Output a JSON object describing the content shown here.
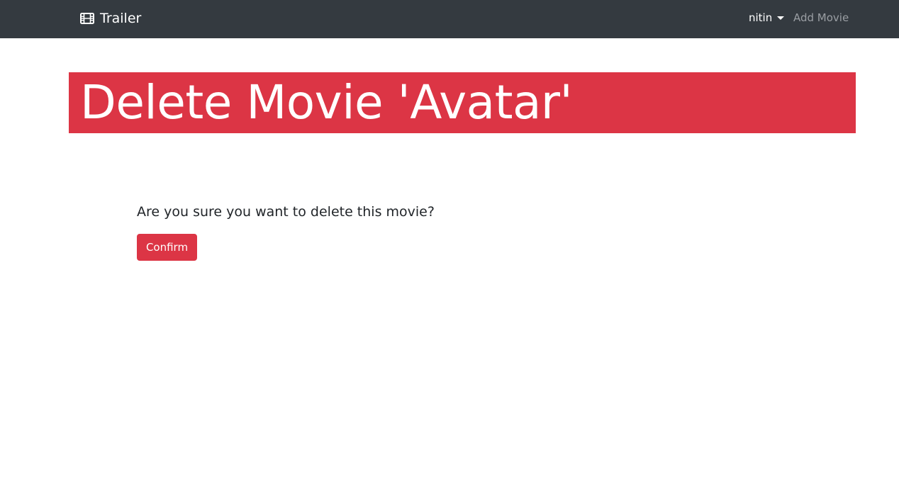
{
  "navbar": {
    "brand": {
      "icon": "film-icon",
      "label": "Trailer"
    },
    "user_menu": {
      "label": "nitin",
      "icon": "caret-down-icon"
    },
    "add_movie_link": "Add Movie"
  },
  "banner": {
    "title": "Delete Movie 'Avatar'"
  },
  "main": {
    "question": "Are you sure you want to delete this movie?",
    "confirm_label": "Confirm"
  },
  "colors": {
    "navbar_bg": "#343a40",
    "danger": "#dc3545",
    "nav_muted": "#9a9ea3",
    "text": "#212529"
  }
}
